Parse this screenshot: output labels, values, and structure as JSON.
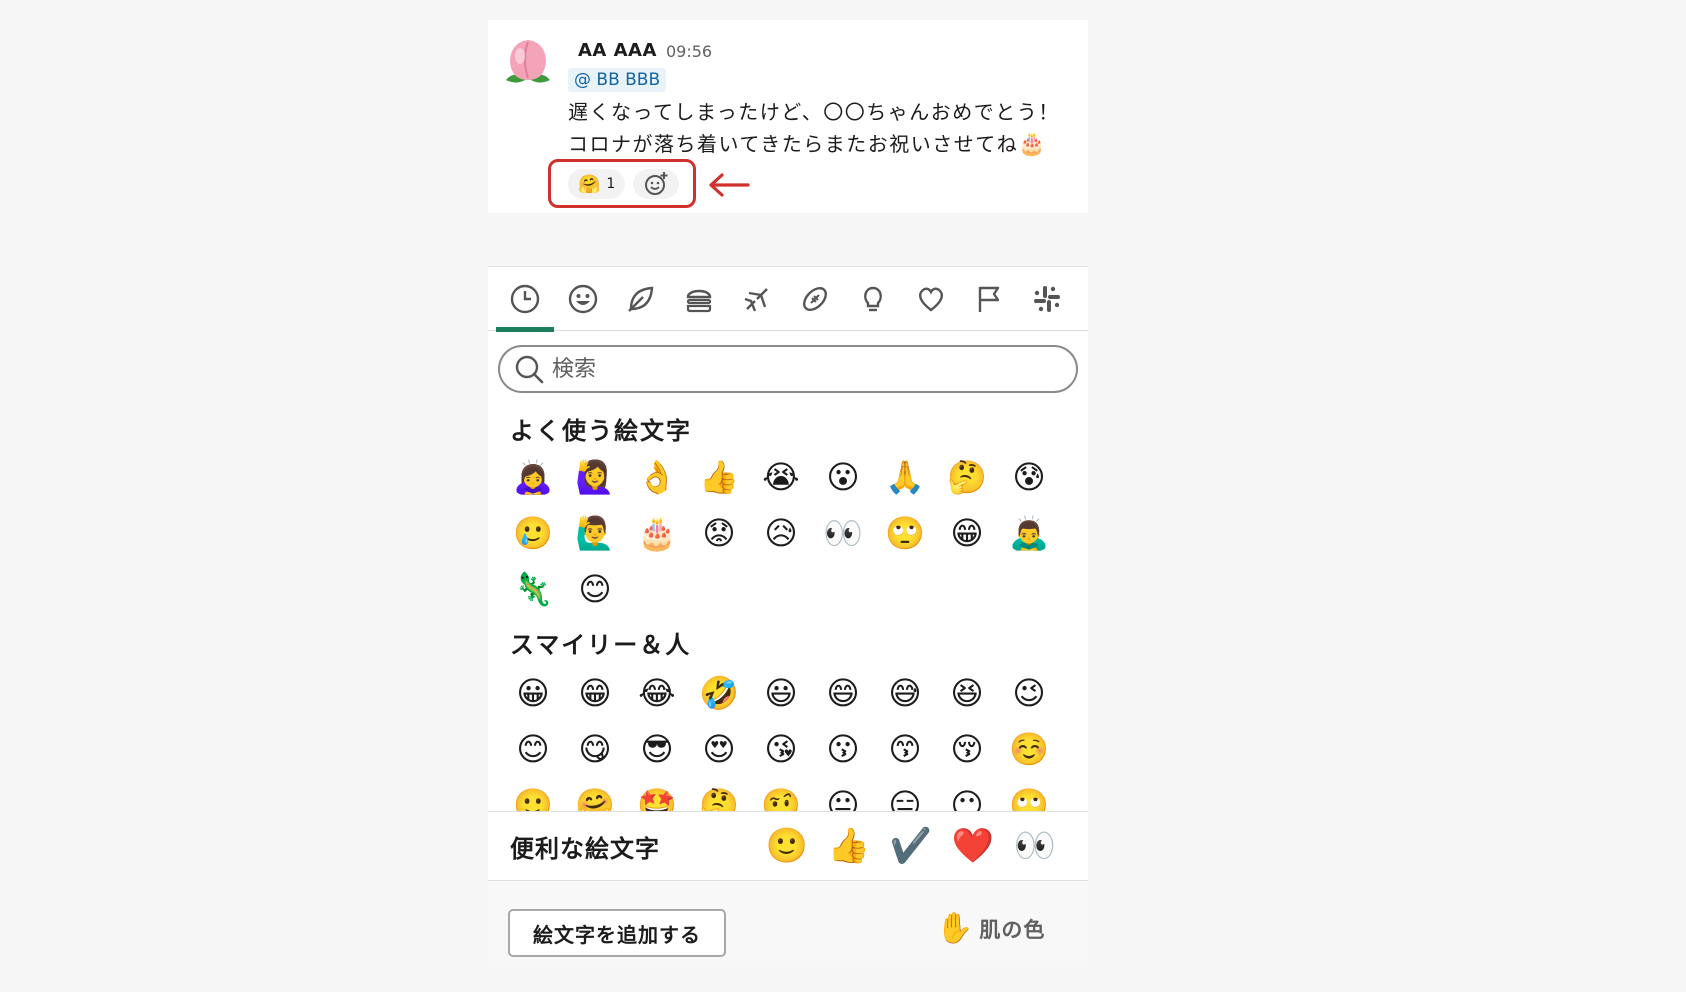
{
  "message": {
    "sender": "AA AAA",
    "time": "09:56",
    "mention": "@ BB BBB",
    "line1": "遅くなってしまったけど、〇〇ちゃんおめでとう！",
    "line2": "コロナが落ち着いてきたらまたお祝いさせてね",
    "line2_emoji": "🎂",
    "reactions": [
      {
        "emoji": "🤗",
        "count": "1"
      }
    ],
    "add_reaction_icon": "add-reaction-icon"
  },
  "annotation": {
    "color": "#d0312d"
  },
  "picker": {
    "tabs": [
      "recent-icon",
      "smiley-icon",
      "nature-icon",
      "food-icon",
      "travel-icon",
      "activity-icon",
      "objects-icon",
      "symbols-icon",
      "flags-icon",
      "slack-icon"
    ],
    "search_placeholder": "検索",
    "frequent_title": "よく使う絵文字",
    "frequent": [
      "🙇‍♀️",
      "🙋‍♀️",
      "👌",
      "👍",
      "😭",
      "😮",
      "🙏",
      "🤔",
      "😰",
      "🥲",
      "🙋‍♂️",
      "🎂",
      "😟",
      "😥",
      "👀",
      "🙄",
      "😁",
      "🙇‍♂️",
      "🦎",
      "😊"
    ],
    "smileys_title": "スマイリー＆人",
    "smileys": [
      "😀",
      "😁",
      "😂",
      "🤣",
      "😃",
      "😄",
      "😅",
      "😆",
      "😉",
      "😊",
      "😋",
      "😎",
      "😍",
      "😘",
      "😗",
      "😙",
      "😚",
      "☺️",
      "🙂",
      "🤗",
      "🤩",
      "🤔",
      "🤨",
      "😐",
      "😑",
      "😶",
      "🙄"
    ],
    "handy_label": "便利な絵文字",
    "handy": [
      "🙂",
      "👍",
      "✔️",
      "❤️",
      "👀"
    ],
    "add_button": "絵文字を追加する",
    "skin_label": "肌の色",
    "skin_emoji": "✋",
    "accent": "#1a7f5a"
  }
}
